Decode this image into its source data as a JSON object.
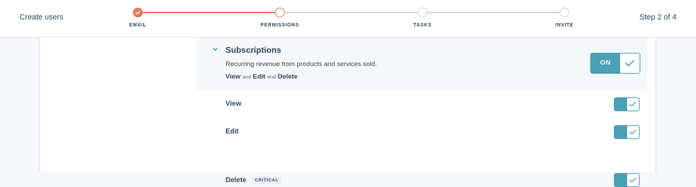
{
  "header": {
    "title": "Create users",
    "step_indicator": "Step 2 of 4",
    "steps": [
      {
        "label": "EMAIL",
        "state": "completed"
      },
      {
        "label": "PERMISSIONS",
        "state": "current"
      },
      {
        "label": "TASKS",
        "state": "upcoming"
      },
      {
        "label": "INVITE",
        "state": "upcoming"
      }
    ]
  },
  "subscriptions": {
    "title": "Subscriptions",
    "description": "Recurring revenue from products and services sold.",
    "summary": {
      "view": "View",
      "and1": "and",
      "edit": "Edit",
      "and2": "and",
      "delete": "Delete"
    },
    "toggle_label": "ON",
    "toggle_state": true
  },
  "permissions": [
    {
      "label": "View",
      "badge": "",
      "enabled": true
    },
    {
      "label": "Edit",
      "badge": "",
      "enabled": true
    },
    {
      "label": "Delete",
      "badge": "CRITICAL",
      "enabled": true
    }
  ],
  "colors": {
    "accent": "#4aa0b5",
    "progress": "#e07a5f",
    "text": "#33475b"
  }
}
